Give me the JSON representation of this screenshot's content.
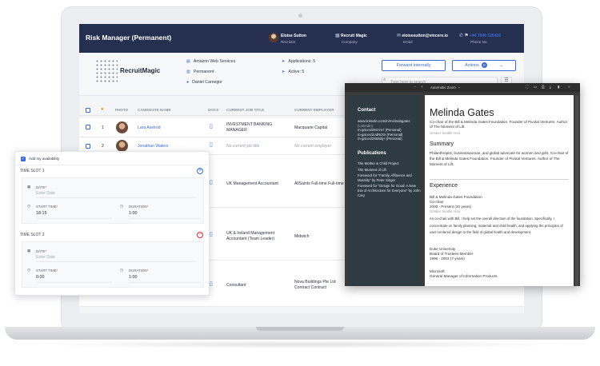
{
  "header": {
    "title": "Risk Manager (Permanent)",
    "contact_name": "Eloise Sutton",
    "contact_role": "Recruiter",
    "company_name": "Recruit Magic",
    "company_label": "Company",
    "email": "eloisesutton@vincere.io",
    "email_label": "Email",
    "phone": "+44 7946 526426",
    "phone_label": "Phone No."
  },
  "info": {
    "logo": "RecruitMagic",
    "company": "Amazon Web Services",
    "type": "Permanent",
    "owner": "Daniel Carnegie",
    "applications": "Applications: 5",
    "active": "Active: 5",
    "forward_button": "Forward internally",
    "actions_button": "Actions",
    "actions_count": "0",
    "filter_placeholder": "Type here to search"
  },
  "table": {
    "headers": [
      "PHOTO",
      "CANDIDATE NAME",
      "DOCS",
      "CURRENT JOB TITLE",
      "CURRENT EMPLOYER"
    ],
    "rows": [
      {
        "num": "1",
        "name": "Lara Axelrod",
        "title": "INVESTMENT BANKING MANAGER",
        "employer": "Macquarie Capital"
      },
      {
        "num": "2",
        "name": "Jonathan Waters",
        "title": "No current job title",
        "employer": "No current employer"
      },
      {
        "num": "",
        "name": "",
        "title": "UK Management Accountant",
        "employer": "AllSaints Full-time Full-time"
      },
      {
        "num": "",
        "name": "",
        "title": "UK & Ireland Management Accountant (Team Leader)",
        "employer": "Midwich"
      },
      {
        "num": "",
        "name": "",
        "title": "Consultant",
        "employer": "Nova Buildings Pte Ltd Contract Contract"
      }
    ]
  },
  "availability": {
    "checkbox_label": "Add my availability",
    "slot1": {
      "title": "TIME SLOT 1",
      "date_label": "DATE",
      "date_placeholder": "Enter Date",
      "start_label": "START TIME",
      "start_value": "18:15",
      "duration_label": "DURATION",
      "duration_value": "1:00"
    },
    "slot2": {
      "title": "TIME SLOT 2",
      "date_label": "DATE",
      "date_placeholder": "Enter Date",
      "start_label": "START TIME",
      "start_value": "0:00",
      "duration_label": "DURATION",
      "duration_value": "1:00"
    }
  },
  "pdf": {
    "zoom": "Automatic Zoom",
    "contact_heading": "Contact",
    "contact_lines": [
      "www.linkedin.com/in/melindagates",
      "(LinkedIn)",
      "m-gat.es/2M1Yo7 (Personal)",
      "m-gat.es/2odNO0r (Personal)",
      "m-gat.es/2S5Nbj-I (Personal)"
    ],
    "publications_heading": "Publications",
    "publications": [
      "The Mother & Child Project",
      "The Moment of Lift",
      "Foreword for \"Family, Affluence and Morality\" by Peter Singer",
      "Foreword for \"Design for Good: A New Era of Architecture for Everyone\" by John Cary"
    ],
    "name": "Melinda Gates",
    "headline": "Co-chair of the Bill & Melinda Gates Foundation. Founder of Pivotal Ventures. Author of The Moment of Lift.",
    "location": "Greater Seattle Area",
    "summary_heading": "Summary",
    "summary": "Philanthropist, businesswoman, and global advocate for women and girls. Co-chair of the Bill & Melinda Gates Foundation. Founder of Pivotal Ventures. Author of The Moment of Lift.",
    "experience_heading": "Experience",
    "exp1_org": "Bill & Melinda Gates Foundation",
    "exp1_role": "Co-chair",
    "exp1_dates": "2000 - Present (20 years)",
    "exp1_loc": "Greater Seattle Area",
    "exp1_desc": "As co-chair with Bill, I help set the overall direction of the foundation. Specifically, I concentrate on family planning, maternal and child health, and applying the principles of user-centered design to the field of global health and development.",
    "exp2_org": "Duke University",
    "exp2_role": "Board of Trustees Member",
    "exp2_dates": "1996 - 2003 (7 years)",
    "exp3_org": "Microsoft",
    "exp3_role": "General Manager of Information Products"
  }
}
